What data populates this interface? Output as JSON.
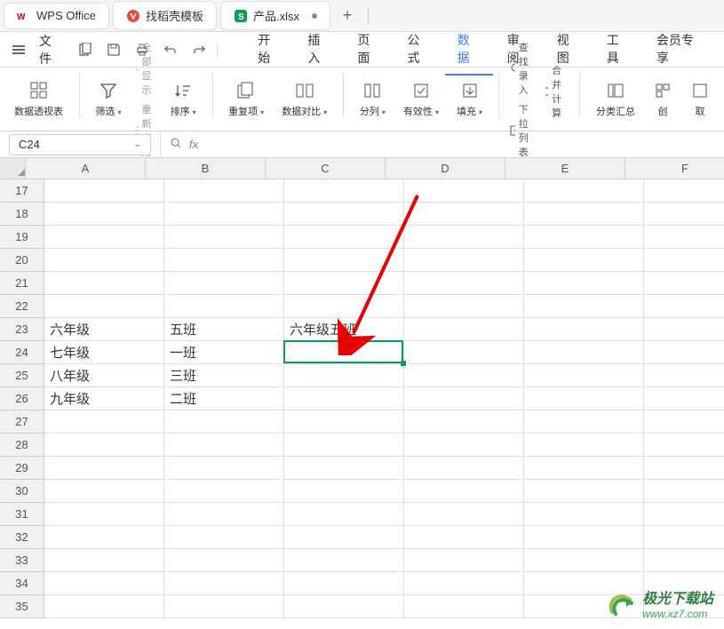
{
  "tabs": [
    {
      "icon": "wps",
      "label": "WPS Office",
      "iconColor": "#d0021b"
    },
    {
      "icon": "dao",
      "label": "找稻壳模板",
      "iconColor": "#e94b35"
    },
    {
      "icon": "xls",
      "label": "产品.xlsx",
      "iconColor": "#0a9d57",
      "hasDot": true
    }
  ],
  "menu": {
    "file": "文件",
    "items": [
      "开始",
      "插入",
      "页面",
      "公式",
      "数据",
      "审阅",
      "视图",
      "工具",
      "会员专享"
    ],
    "activeIndex": 4
  },
  "toolbar": {
    "pivotTable": "数据透视表",
    "filter": "筛选",
    "showAll": "全部显示",
    "reapply": "重新应用",
    "sort": "排序",
    "duplicates": "重复项",
    "dataCompare": "数据对比",
    "splitCol": "分列",
    "validity": "有效性",
    "fill": "填充",
    "findRecord": "查找录入",
    "dropdownList": "下拉列表",
    "consolidate": "合并计算",
    "subtotal": "分类汇总",
    "getData": "取消",
    "create": "创"
  },
  "formulaBar": {
    "cellRef": "C24",
    "fx": "fx"
  },
  "columns": [
    "A",
    "B",
    "C",
    "D",
    "E",
    "F"
  ],
  "startRow": 17,
  "rowCount": 19,
  "cellData": {
    "23": {
      "A": "六年级",
      "B": "五班",
      "C": "六年级五班"
    },
    "24": {
      "A": "七年级",
      "B": "一班"
    },
    "25": {
      "A": "八年级",
      "B": "三班"
    },
    "26": {
      "A": "九年级",
      "B": "二班"
    }
  },
  "activeCell": {
    "row": 24,
    "col": "C",
    "colIndex": 2
  },
  "watermark": {
    "title": "极光下载站",
    "url": "www.xz7.com"
  }
}
